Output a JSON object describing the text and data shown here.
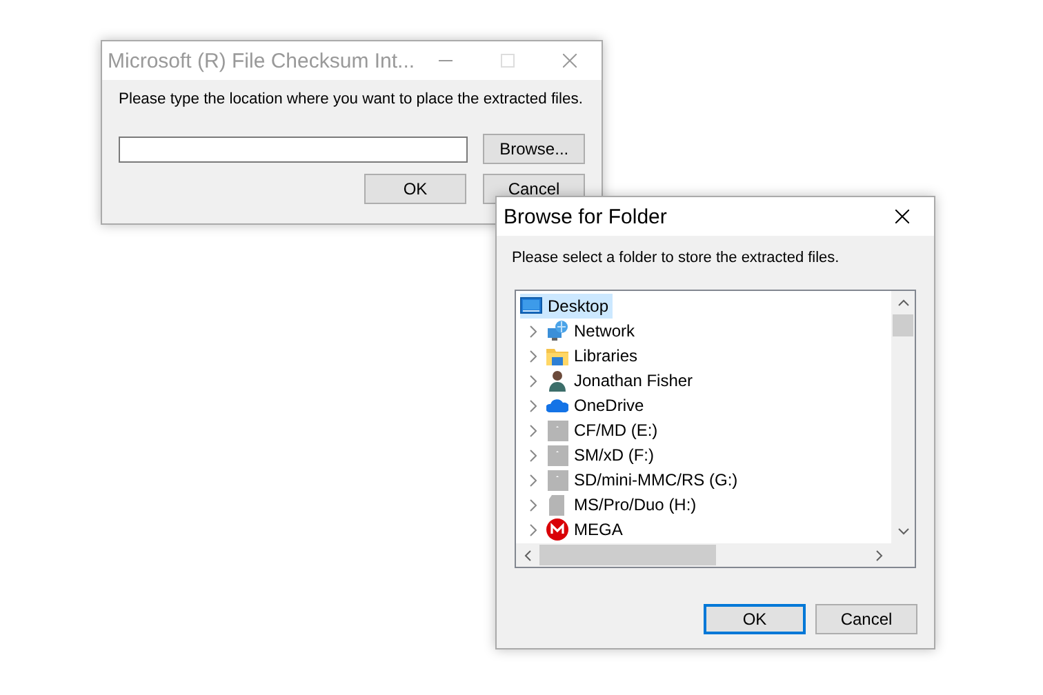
{
  "back_window": {
    "title": "Microsoft (R) File Checksum Int...",
    "active": false,
    "prompt": "Please type the location where you want to place the extracted files.",
    "browse_button": "Browse...",
    "buttons": [
      {
        "label": "OK"
      },
      {
        "label": "Cancel"
      }
    ]
  },
  "browse_window": {
    "title": "Browse for Folder",
    "active": true,
    "prompt": "Please select a folder to store the extracted files.",
    "tree": [
      {
        "label": "Desktop",
        "kind": "desktop",
        "selected": true,
        "children": [
          {
            "label": "Network",
            "kind": "network",
            "selected": false,
            "expanded": false
          },
          {
            "label": "Libraries",
            "kind": "libraries",
            "selected": false,
            "expanded": false
          },
          {
            "label": "Jonathan Fisher",
            "kind": "user",
            "selected": false,
            "expanded": false
          },
          {
            "label": "OneDrive",
            "kind": "cloud",
            "selected": false,
            "expanded": false
          },
          {
            "label": "CF/MD (E:)",
            "kind": "drive",
            "selected": false,
            "expanded": false
          },
          {
            "label": "SM/xD (F:)",
            "kind": "drive",
            "selected": false,
            "expanded": false
          },
          {
            "label": "SD/mini-MMC/RS (G:)",
            "kind": "drive",
            "selected": false,
            "expanded": false
          },
          {
            "label": "MS/Pro/Duo (H:)",
            "kind": "card",
            "selected": false,
            "expanded": false
          },
          {
            "label": "MEGA",
            "kind": "mega",
            "selected": false,
            "expanded": false
          }
        ]
      }
    ],
    "buttons": [
      {
        "label": "OK",
        "default": true
      },
      {
        "label": "Cancel",
        "default": false
      }
    ]
  }
}
